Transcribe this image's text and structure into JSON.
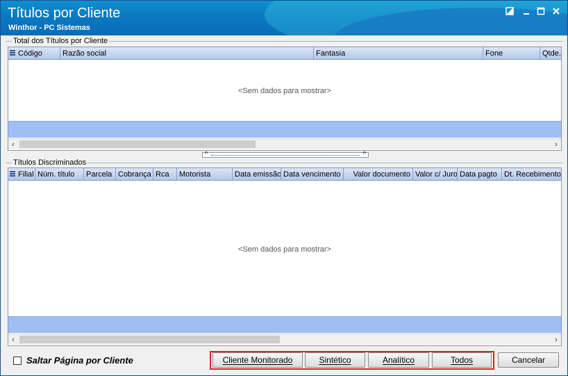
{
  "window": {
    "title": "Títulos por Cliente",
    "subtitle": "Winthor - PC Sistemas",
    "controls": [
      "restore-icon",
      "minimize-icon",
      "maximize-icon",
      "close-icon"
    ]
  },
  "summary_group": {
    "label": "Total dos Títulos por Cliente",
    "columns": [
      "Código",
      "Razão social",
      "Fantasia",
      "Fone",
      "Qtde."
    ],
    "empty_text": "<Sem dados para mostrar>"
  },
  "detail_group": {
    "label": "Títulos Discriminados",
    "columns": [
      "Filial",
      "Núm. título",
      "Parcela",
      "Cobrança",
      "Rca",
      "Motorista",
      "Data emissão",
      "Data vencimento",
      "Valor documento",
      "Valor c/ Juros",
      "Data pagto",
      "Dt. Recebimento"
    ],
    "empty_text": "<Sem dados para mostrar>"
  },
  "footer": {
    "checkbox_label": "Saltar Página por Cliente",
    "checkbox_checked": false,
    "buttons": {
      "cliente_monitorado": "Cliente Monitorado",
      "sintetico": "Sintético",
      "analitico": "Analítico",
      "todos": "Todos",
      "cancelar": "Cancelar"
    }
  },
  "colors": {
    "title_bar": "#0a79c1",
    "grid_header": "#c6d6f2",
    "footer_band": "#9fbef1",
    "highlight": "#e5202a"
  }
}
